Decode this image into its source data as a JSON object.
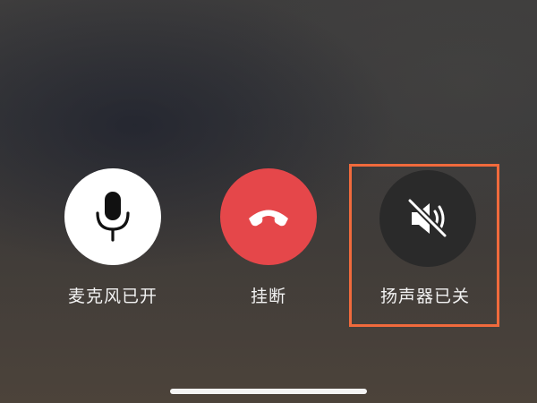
{
  "call_controls": {
    "microphone": {
      "label": "麦克风已开",
      "icon": "microphone-icon",
      "state": "on"
    },
    "hangup": {
      "label": "挂断",
      "icon": "phone-hangup-icon",
      "color": "#e5474a"
    },
    "speaker": {
      "label": "扬声器已关",
      "icon": "speaker-muted-icon",
      "state": "off"
    }
  },
  "highlight": {
    "target": "speaker",
    "color": "#f06a3c"
  }
}
